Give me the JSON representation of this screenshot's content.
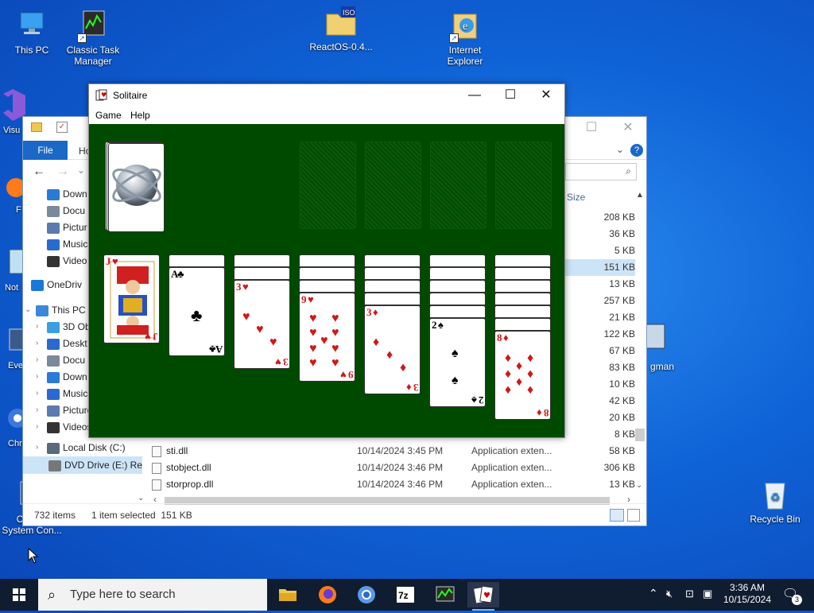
{
  "desktop": {
    "icons": [
      {
        "label": "This PC",
        "icon": "computer-icon"
      },
      {
        "label": "Classic Task Manager",
        "icon": "task-manager-icon"
      },
      {
        "label": "ReactOS-0.4...",
        "icon": "iso-folder-icon"
      },
      {
        "label": "Internet Explorer",
        "icon": "internet-explorer-icon"
      },
      {
        "label": "Recycle Bin",
        "icon": "recycle-bin-icon"
      },
      {
        "label": "Classic System Con...",
        "icon": "system-control-icon"
      }
    ],
    "left_partial": [
      "Visu",
      "F",
      "Not",
      "Eve",
      "Chr"
    ],
    "right_partial": "gman"
  },
  "explorer": {
    "file_tab": "File",
    "home_tab_partial": "Ho",
    "nav": [
      {
        "label": "Down",
        "icon": "download-icon",
        "color": "#2a7ad8"
      },
      {
        "label": "Docu",
        "icon": "document-icon",
        "color": "#7a8a9a"
      },
      {
        "label": "Pictur",
        "icon": "pictures-icon",
        "color": "#5a7ab0"
      },
      {
        "label": "Music",
        "icon": "music-icon",
        "color": "#2a6ad0"
      },
      {
        "label": "Video",
        "icon": "video-icon",
        "color": "#333333"
      },
      {
        "label": "OneDriv",
        "icon": "onedrive-icon",
        "color": "#1a78d8"
      },
      {
        "label": "This PC",
        "icon": "computer-icon",
        "color": "#3a8ad8"
      },
      {
        "label": "3D Ob",
        "icon": "3d-objects-icon",
        "color": "#3aa0e0"
      },
      {
        "label": "Deskt",
        "icon": "desktop-folder-icon",
        "color": "#2a6ad0"
      },
      {
        "label": "Docu",
        "icon": "document-icon",
        "color": "#7a8a9a"
      },
      {
        "label": "Down",
        "icon": "download-icon",
        "color": "#2a7ad8"
      },
      {
        "label": "Music",
        "icon": "music-icon",
        "color": "#2a6ad0"
      },
      {
        "label": "Pictures",
        "icon": "pictures-icon",
        "color": "#5a7ab0"
      },
      {
        "label": "Videos",
        "icon": "video-icon",
        "color": "#333333"
      },
      {
        "label": "Local Disk (C:)",
        "icon": "drive-icon",
        "color": "#5a6a7a"
      },
      {
        "label": "DVD Drive (E:) Re",
        "icon": "dvd-drive-icon",
        "color": "#777777"
      }
    ],
    "size_header": "Size",
    "sizes": [
      "208 KB",
      "36 KB",
      "5 KB",
      "151 KB",
      "13 KB",
      "257 KB",
      "21 KB",
      "122 KB",
      "67 KB",
      "83 KB",
      "10 KB",
      "42 KB",
      "20 KB",
      "8 KB"
    ],
    "selected_index": 3,
    "files": [
      {
        "name": "sti.dll",
        "date": "10/14/2024 3:45 PM",
        "type": "Application exten...",
        "size": "58 KB"
      },
      {
        "name": "stobject.dll",
        "date": "10/14/2024 3:46 PM",
        "type": "Application exten...",
        "size": "306 KB"
      },
      {
        "name": "storprop.dll",
        "date": "10/14/2024 3:46 PM",
        "type": "Application exten...",
        "size": "13 KB"
      }
    ],
    "status": {
      "items": "732 items",
      "selected": "1 item selected  151 KB"
    }
  },
  "solitaire": {
    "title": "Solitaire",
    "menu": [
      "Game",
      "Help"
    ],
    "stock": {
      "back_icon": "chrome-sphere-card-back"
    },
    "tableau": [
      {
        "face_down": 0,
        "rank": "J",
        "suit": "♥",
        "color": "red",
        "face_card": true
      },
      {
        "face_down": 1,
        "rank": "A",
        "suit": "♣",
        "color": "blk"
      },
      {
        "face_down": 2,
        "rank": "3",
        "suit": "♥",
        "color": "red"
      },
      {
        "face_down": 3,
        "rank": "9",
        "suit": "♥",
        "color": "red"
      },
      {
        "face_down": 4,
        "rank": "3",
        "suit": "♦",
        "color": "red"
      },
      {
        "face_down": 5,
        "rank": "2",
        "suit": "♠",
        "color": "blk"
      },
      {
        "face_down": 6,
        "rank": "8",
        "suit": "♦",
        "color": "red"
      }
    ]
  },
  "taskbar": {
    "search_placeholder": "Type here to search",
    "time": "3:36 AM",
    "date": "10/15/2024",
    "notifications": "3"
  }
}
